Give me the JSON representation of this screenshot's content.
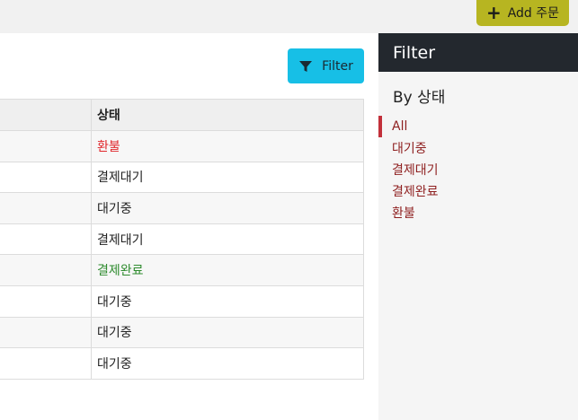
{
  "header": {
    "add_button_label": "Add 주문",
    "add_button_icon": "plus-icon"
  },
  "toolbar": {
    "filter_button_label": "Filter",
    "filter_icon": "funnel-icon"
  },
  "table": {
    "columns": [
      "",
      "상태"
    ],
    "rows": [
      {
        "status": "환불",
        "color": "#e0262b"
      },
      {
        "status": "결제대기",
        "color": "#222222"
      },
      {
        "status": "대기중",
        "color": "#222222"
      },
      {
        "status": "결제대기",
        "color": "#222222"
      },
      {
        "status": "결제완료",
        "color": "#2e8b2e"
      },
      {
        "status": "대기중",
        "color": "#222222"
      },
      {
        "status": "대기중",
        "color": "#222222"
      },
      {
        "status": "대기중",
        "color": "#222222"
      }
    ]
  },
  "sidebar": {
    "title": "Filter",
    "section_title": "By 상태",
    "items": [
      {
        "label": "All",
        "active": true
      },
      {
        "label": "대기중",
        "active": false
      },
      {
        "label": "결제대기",
        "active": false
      },
      {
        "label": "결제완료",
        "active": false
      },
      {
        "label": "환불",
        "active": false
      }
    ]
  },
  "colors": {
    "accent_yellow": "#b7b521",
    "accent_cyan": "#17bfe6",
    "sidebar_dark": "#23282e",
    "active_bar": "#c2303a"
  }
}
